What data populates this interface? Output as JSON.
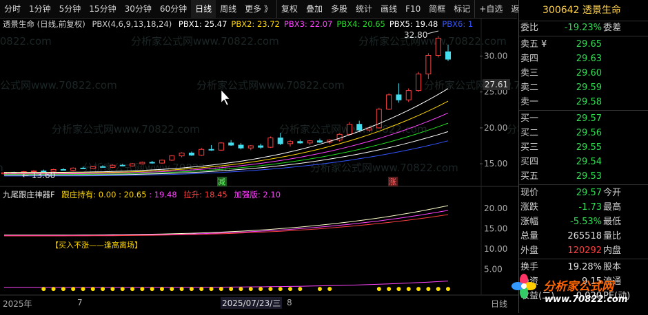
{
  "toolbar": {
    "items": [
      "分时",
      "1分钟",
      "5分钟",
      "15分钟",
      "30分钟",
      "60分钟",
      "日线",
      "周线",
      "更多 》",
      "复权",
      "叠加",
      "多股",
      "统计",
      "画线",
      "F10",
      "简框",
      "标记",
      "+自选",
      "返回"
    ]
  },
  "main_chart": {
    "title": "透景生命 (日线,前复权)",
    "pbx_def": "PBX(4,6,9,13,18,24)",
    "pbx": [
      {
        "label": "PBX1: 25.47",
        "color": "#ffffff"
      },
      {
        "label": "PBX2: 23.72",
        "color": "#ffd700"
      },
      {
        "label": "PBX3: 22.07",
        "color": "#ff44ff"
      },
      {
        "label": "PBX4: 20.65",
        "color": "#22dd22"
      },
      {
        "label": "PBX5: 19.48",
        "color": "#ffffff"
      },
      {
        "label": "PBX6: 1",
        "color": "#3355ff"
      }
    ],
    "high_label": "32.80",
    "low_label": "← 13.60",
    "current_price_tag": "27.61",
    "y_ticks": [
      "30.00",
      "25.00",
      "20.00",
      "15.00"
    ],
    "signal_jian": "减",
    "signal_zhang": "涨",
    "candles": [
      [
        13.6,
        13.8,
        13.5,
        13.75
      ],
      [
        13.8,
        13.9,
        13.6,
        13.7
      ],
      [
        13.7,
        14.0,
        13.6,
        13.9
      ],
      [
        13.9,
        14.1,
        13.8,
        14.0
      ],
      [
        14.0,
        14.2,
        13.9,
        13.95
      ],
      [
        13.95,
        14.3,
        13.9,
        14.2
      ],
      [
        14.2,
        14.4,
        14.1,
        14.1
      ],
      [
        14.1,
        14.5,
        14.0,
        14.4
      ],
      [
        14.4,
        14.6,
        14.3,
        14.35
      ],
      [
        14.35,
        14.7,
        14.3,
        14.6
      ],
      [
        14.6,
        14.8,
        14.5,
        14.5
      ],
      [
        14.5,
        14.9,
        14.4,
        14.8
      ],
      [
        14.8,
        15.0,
        14.7,
        14.7
      ],
      [
        14.7,
        15.1,
        14.6,
        15.0
      ],
      [
        15.0,
        15.3,
        14.9,
        15.2
      ],
      [
        15.2,
        15.4,
        15.0,
        15.1
      ],
      [
        15.1,
        15.6,
        15.0,
        15.5
      ],
      [
        15.5,
        16.2,
        15.4,
        16.1
      ],
      [
        16.1,
        16.6,
        15.9,
        16.5
      ],
      [
        16.5,
        16.7,
        16.1,
        16.2
      ],
      [
        16.2,
        17.2,
        16.1,
        17.0
      ],
      [
        17.0,
        17.6,
        16.8,
        16.9
      ],
      [
        16.9,
        18.0,
        16.8,
        17.9
      ],
      [
        17.9,
        18.3,
        17.5,
        17.6
      ],
      [
        17.6,
        17.9,
        17.0,
        17.2
      ],
      [
        17.2,
        17.6,
        16.9,
        17.5
      ],
      [
        17.5,
        17.8,
        17.1,
        17.3
      ],
      [
        17.3,
        18.8,
        17.2,
        18.6
      ],
      [
        18.6,
        19.3,
        17.6,
        17.8
      ],
      [
        17.8,
        18.3,
        17.4,
        18.1
      ],
      [
        18.1,
        18.4,
        17.8,
        17.9
      ],
      [
        17.9,
        18.3,
        17.6,
        18.2
      ],
      [
        18.2,
        18.5,
        17.9,
        18.0
      ],
      [
        18.0,
        18.4,
        17.8,
        18.3
      ],
      [
        18.3,
        19.2,
        18.1,
        19.1
      ],
      [
        19.1,
        20.8,
        19.0,
        20.5
      ],
      [
        20.5,
        21.0,
        19.4,
        19.7
      ],
      [
        19.7,
        20.2,
        19.4,
        20.0
      ],
      [
        20.0,
        22.8,
        19.9,
        22.6
      ],
      [
        22.6,
        24.8,
        22.5,
        24.6
      ],
      [
        24.6,
        26.2,
        23.5,
        23.9
      ],
      [
        23.9,
        25.5,
        23.6,
        25.2
      ],
      [
        25.2,
        27.8,
        25.0,
        27.5
      ],
      [
        27.5,
        30.4,
        26.8,
        30.1
      ],
      [
        30.1,
        32.8,
        29.8,
        32.5
      ],
      [
        30.6,
        31.6,
        29.3,
        29.57
      ]
    ],
    "ma_lines": [
      {
        "name": "PBX1",
        "color": "#ffffff",
        "start": 13.8,
        "end": 25.47
      },
      {
        "name": "PBX2",
        "color": "#ffd700",
        "start": 13.7,
        "end": 23.72
      },
      {
        "name": "PBX3",
        "color": "#ff44ff",
        "start": 13.6,
        "end": 22.07
      },
      {
        "name": "PBX4",
        "color": "#22dd22",
        "start": 13.5,
        "end": 20.65
      },
      {
        "name": "PBX5",
        "color": "#ffffff",
        "start": 13.4,
        "end": 19.48
      },
      {
        "name": "PBX6",
        "color": "#3355ff",
        "start": 13.3,
        "end": 18.2
      }
    ]
  },
  "sub_chart": {
    "name": "九尾跟庄神器F",
    "hold_label": "跟庄持有: 0.00 : 20.65",
    "v2": ": 19.48",
    "lashen": "拉升: 18.45",
    "jiaqiang": "加强版: 2.10",
    "note": "【买入不涨——逢高离场】",
    "y_ticks": [
      "20.00",
      "15.00",
      "10.00",
      "5.00"
    ],
    "dot_color": "#ffdd00"
  },
  "date_axis": {
    "left": "2025年",
    "m1": "7",
    "cursor_date": "2025/07/23/三",
    "m2": "8",
    "right": "日线"
  },
  "watermark": "分析家公式网www.70822.com",
  "panel": {
    "code_name": "300642 透景生命",
    "weibi_label": "委比",
    "weibi_val": "-19.23%",
    "weicha_label": "委差",
    "asks": [
      {
        "label": "卖五",
        "val": "29.65",
        "mark": "¥"
      },
      {
        "label": "卖四",
        "val": "29.63"
      },
      {
        "label": "卖三",
        "val": "29.60"
      },
      {
        "label": "卖二",
        "val": "29.59"
      },
      {
        "label": "卖一",
        "val": "29.58"
      }
    ],
    "bids": [
      {
        "label": "买一",
        "val": "29.57"
      },
      {
        "label": "买二",
        "val": "29.56"
      },
      {
        "label": "买三",
        "val": "29.55"
      },
      {
        "label": "买四",
        "val": "29.54"
      },
      {
        "label": "买五",
        "val": "29.53"
      }
    ],
    "stats": [
      {
        "l": "现价",
        "v": "29.57",
        "c": "green",
        "r": "今开"
      },
      {
        "l": "涨跌",
        "v": "-1.73",
        "c": "green",
        "r": "最高"
      },
      {
        "l": "涨幅",
        "v": "-5.53%",
        "c": "green",
        "r": "最低"
      },
      {
        "l": "总量",
        "v": "265518",
        "c": "white",
        "r": "量比"
      },
      {
        "l": "外盘",
        "v": "120292",
        "c": "red",
        "r": "内盘"
      }
    ],
    "stats2": [
      {
        "l": "换手",
        "v": "19.28%",
        "r": "股本"
      },
      {
        "l": "净资",
        "v": "9.15",
        "r": "流通"
      },
      {
        "l": "收益(二)",
        "v": "0.020",
        "r": "PE(动)"
      }
    ],
    "brand_name": "分析家公式网",
    "brand_url": "www.70822.com"
  }
}
